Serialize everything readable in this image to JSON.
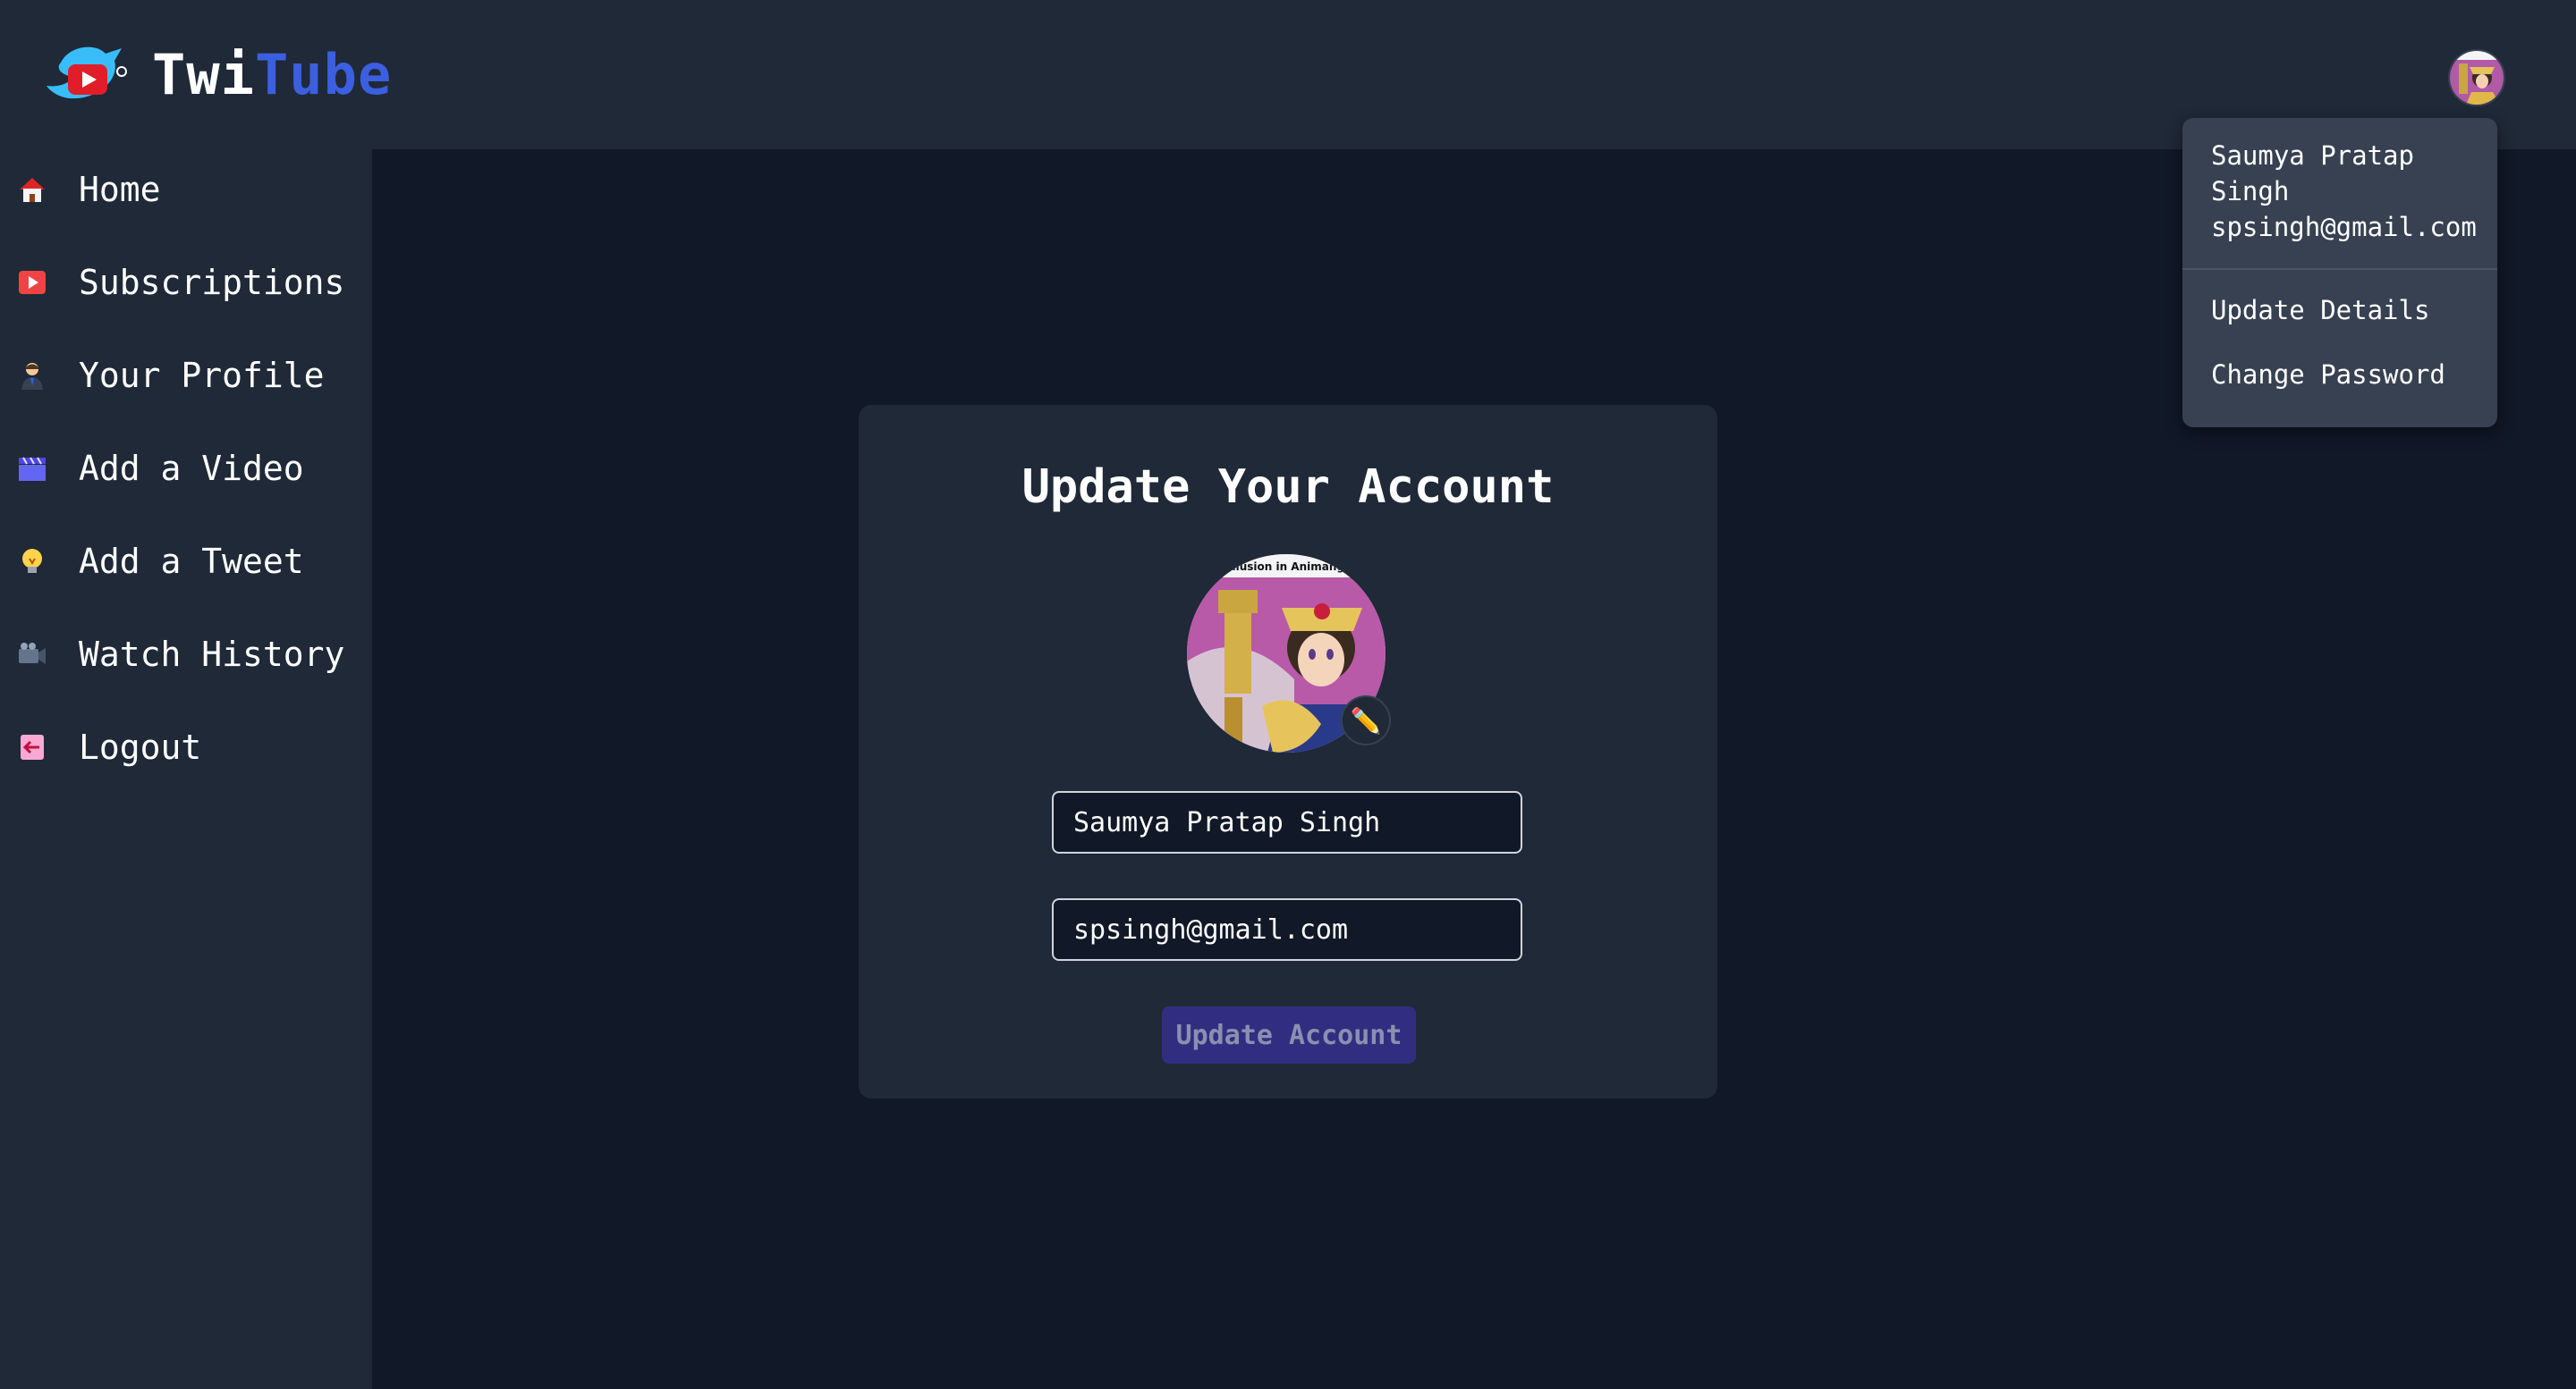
{
  "brand": {
    "part1": "Twi",
    "part2": "Tube"
  },
  "sidebar": {
    "items": [
      {
        "label": "Home",
        "icon": "house-icon"
      },
      {
        "label": "Subscriptions",
        "icon": "play-button-icon"
      },
      {
        "label": "Your Profile",
        "icon": "person-icon"
      },
      {
        "label": "Add a Video",
        "icon": "clapperboard-icon"
      },
      {
        "label": "Add a Tweet",
        "icon": "lightbulb-icon"
      },
      {
        "label": "Watch History",
        "icon": "video-camera-icon"
      },
      {
        "label": "Logout",
        "icon": "logout-arrow-icon"
      }
    ]
  },
  "form": {
    "title": "Update Your Account",
    "fullname_value": "Saumya Pratap Singh",
    "email_value": "spsingh@gmail.com",
    "submit_label": "Update Account",
    "avatar_caption": "Illusion in Animang"
  },
  "dropdown": {
    "name": "Saumya Pratap Singh",
    "email": "spsingh@gmail.com",
    "update_details": "Update Details",
    "change_password": "Change Password"
  },
  "colors": {
    "background": "#111827",
    "panel": "#1f2937",
    "accent_blue": "#3b5fe0",
    "button": "#312e81"
  }
}
